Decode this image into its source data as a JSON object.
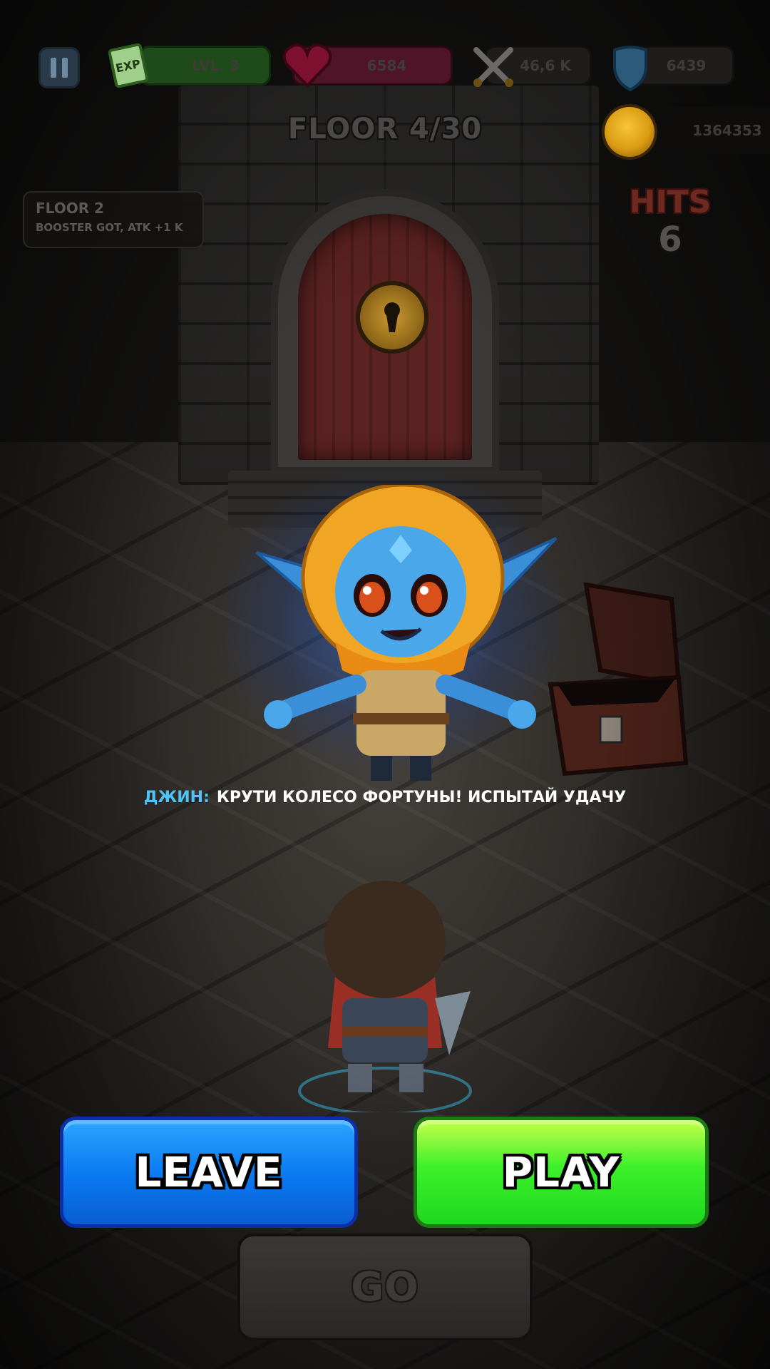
{
  "hud": {
    "level_label": "LVL. 3",
    "exp_badge": "EXP",
    "hp_value": "6584",
    "attack_value": "46,6 K",
    "defense_value": "6439",
    "gold_value": "1364353"
  },
  "floor": {
    "title": "FLOOR 4/30"
  },
  "hits": {
    "label": "HITS",
    "value": "6"
  },
  "log": {
    "title": "FLOOR 2",
    "text": "BOOSTER GOT, ATK +1 K"
  },
  "dialogue": {
    "speaker": "ДЖИН:",
    "text": "КРУТИ КОЛЕСО ФОРТУНЫ! ИСПЫТАЙ УДАЧУ"
  },
  "buttons": {
    "leave": "LEAVE",
    "play": "PLAY",
    "go": "GO"
  },
  "colors": {
    "leave": "#0a78f0",
    "play": "#3cf02a",
    "speaker": "#4fc3f7",
    "hp": "#4f1428",
    "exp": "#1f4a19"
  },
  "icons": [
    "pause-icon",
    "exp-scroll-icon",
    "heart-icon",
    "crossed-swords-icon",
    "shield-icon",
    "gold-coin-icon",
    "lock-icon"
  ]
}
